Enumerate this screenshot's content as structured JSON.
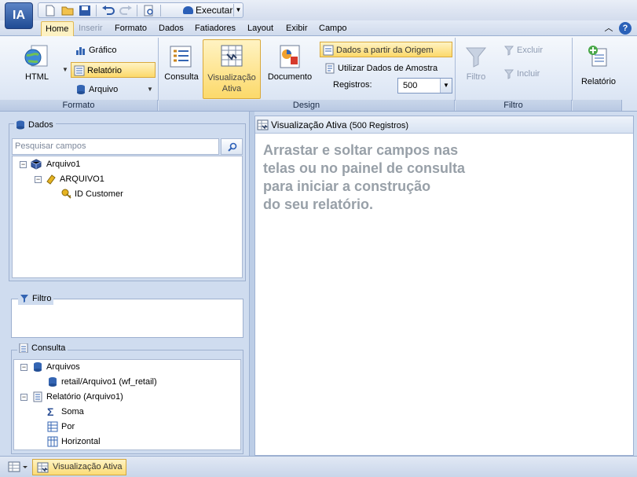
{
  "app": {
    "logo_text": "IA"
  },
  "qat": {
    "run_label": "Executar"
  },
  "menu": {
    "tabs": [
      {
        "label": "Home",
        "state": "active"
      },
      {
        "label": "Inserir",
        "state": "disabled"
      },
      {
        "label": "Formato",
        "state": "normal"
      },
      {
        "label": "Dados",
        "state": "normal"
      },
      {
        "label": "Fatiadores",
        "state": "normal"
      },
      {
        "label": "Layout",
        "state": "normal"
      },
      {
        "label": "Exibir",
        "state": "normal"
      },
      {
        "label": "Campo",
        "state": "normal"
      }
    ],
    "help_label": "?"
  },
  "ribbon": {
    "formato": {
      "title": "Formato",
      "html_label": "HTML",
      "grafico_label": "Gráfico",
      "relatorio_label": "Relatório",
      "arquivo_label": "Arquivo"
    },
    "design": {
      "title": "Design",
      "consulta_label": "Consulta",
      "visualizacao_label_1": "Visualização",
      "visualizacao_label_2": "Ativa",
      "documento_label": "Documento",
      "dados_origem_label": "Dados a partir da Origem",
      "amostra_label": "Utilizar Dados de Amostra",
      "registros_label": "Registros:",
      "registros_value": "500"
    },
    "filtro": {
      "title": "Filtro",
      "filtro_label": "Filtro",
      "excluir_label": "Excluir",
      "incluir_label": "Incluir"
    },
    "relatorio_group": {
      "relatorio_label": "Relatório"
    }
  },
  "left": {
    "dados": {
      "title": "Dados",
      "search_placeholder": "Pesquisar campos",
      "tree": [
        {
          "label": "Arquivo1",
          "glyph": "⊟"
        },
        {
          "label": "ARQUIVO1",
          "glyph": "⊟"
        },
        {
          "label": "ID Customer"
        }
      ]
    },
    "filtro": {
      "title": "Filtro"
    },
    "consulta": {
      "title": "Consulta",
      "tree": [
        {
          "label": "Arquivos",
          "glyph": "⊟"
        },
        {
          "label": "retail/Arquivo1 (wf_retail)"
        },
        {
          "label": "Relatório (Arquivo1)",
          "glyph": "⊟"
        },
        {
          "label": "Soma"
        },
        {
          "label": "Por"
        },
        {
          "label": "Horizontal"
        }
      ]
    }
  },
  "main": {
    "title": "Visualização Ativa",
    "count": "(500 Registros)",
    "hint_lines": [
      "Arrastar e soltar campos nas",
      "telas ou no painel de consulta",
      "para iniciar a construção",
      "do seu relatório."
    ]
  },
  "bottom": {
    "tab_label": "Visualização Ativa"
  },
  "colors": {
    "accent": "#fcd96a",
    "panel": "#cfdcef",
    "link_blue": "#2b5fb7"
  }
}
